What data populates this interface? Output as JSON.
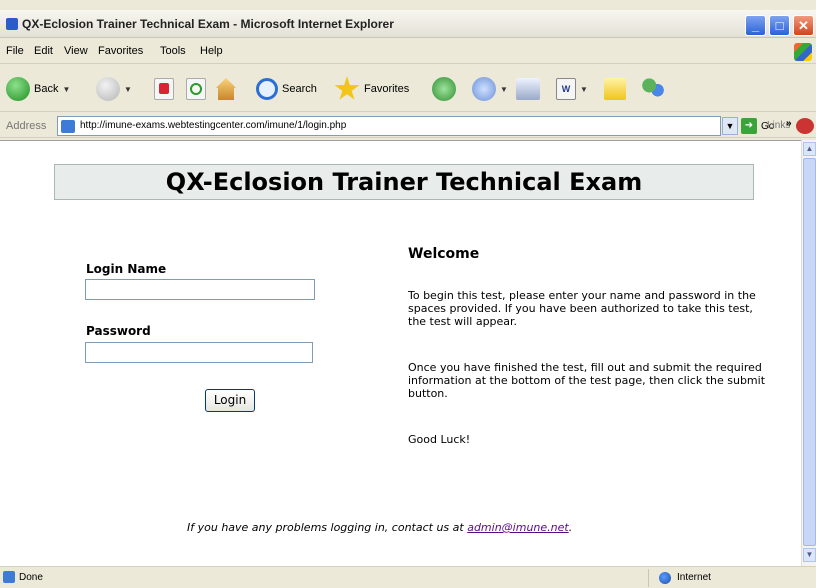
{
  "window": {
    "title": "QX-Eclosion Trainer Technical Exam - Microsoft Internet Explorer",
    "controls": {
      "minimize": "_",
      "maximize": "□",
      "close": "✕"
    }
  },
  "menu": [
    "File",
    "Edit",
    "View",
    "Favorites",
    "Tools",
    "Help"
  ],
  "toolbar": {
    "back": "Back",
    "search": "Search",
    "favorites": "Favorites"
  },
  "address": {
    "label": "Address",
    "url": "http://imune-exams.webtestingcenter.com/imune/1/login.php",
    "go": "Go",
    "links": "Links",
    "links_chevron": "»"
  },
  "page": {
    "header": "QX-Eclosion Trainer Technical Exam",
    "login_name_label": "Login Name",
    "login_name_value": "",
    "password_label": "Password",
    "password_value": "",
    "login_button": "Login",
    "welcome_title": "Welcome",
    "para1": "To begin this test, please enter your name and password in the spaces provided. If you have been authorized to take this test, the test will appear.",
    "para2": "Once you have finished the test, fill out and submit the required information at the bottom of the test page, then click the submit button.",
    "para3": "Good Luck!",
    "footer_text": "If you have any problems logging in, contact us at ",
    "footer_email": "admin@imune.net",
    "footer_end": "."
  },
  "status": {
    "text": "Done",
    "zone": "Internet"
  },
  "colors": {
    "titlebar_text": "#222222",
    "banner_bg": "#e8ecea",
    "link": "#5b0b8a"
  }
}
